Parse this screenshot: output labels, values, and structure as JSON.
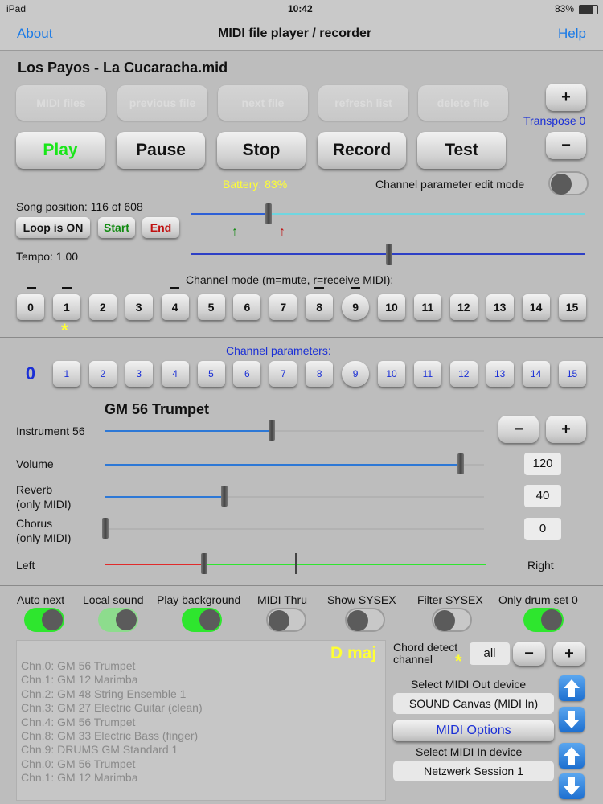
{
  "status": {
    "device": "iPad",
    "time": "10:42",
    "battery": "83%"
  },
  "nav": {
    "about": "About",
    "title": "MIDI file player / recorder",
    "help": "Help"
  },
  "file": {
    "name": "Los Payos - La Cucaracha.mid"
  },
  "file_buttons": [
    "MIDI files",
    "previous file",
    "next file",
    "refresh list",
    "delete file"
  ],
  "transport": {
    "play": "Play",
    "pause": "Pause",
    "stop": "Stop",
    "record": "Record",
    "test": "Test"
  },
  "transpose": {
    "plus": "+",
    "minus": "−",
    "label": "Transpose 0"
  },
  "battery_text": "Battery: 83%",
  "edit_mode": {
    "label": "Channel parameter edit mode",
    "on": false
  },
  "song": {
    "position_label": "Song position: 116 of 608",
    "position": 116,
    "total": 608,
    "loop": "Loop is ON",
    "start": "Start",
    "end": "End"
  },
  "tempo": {
    "label": "Tempo: 1.00",
    "value": 1.0
  },
  "channel_mode": {
    "title": "Channel mode (m=mute, r=receive MIDI):",
    "channels": [
      "0",
      "1",
      "2",
      "3",
      "4",
      "5",
      "6",
      "7",
      "8",
      "9",
      "10",
      "11",
      "12",
      "13",
      "14",
      "15"
    ],
    "marked_channel": "1",
    "marker": "*"
  },
  "channel_params": {
    "title": "Channel parameters:",
    "channels": [
      "0",
      "1",
      "2",
      "3",
      "4",
      "5",
      "6",
      "7",
      "8",
      "9",
      "10",
      "11",
      "12",
      "13",
      "14",
      "15"
    ],
    "selected": "0"
  },
  "instrument": {
    "name": "GM 56  Trumpet",
    "label": "Instrument 56",
    "minus": "−",
    "plus": "+",
    "value": 56
  },
  "volume": {
    "label": "Volume",
    "value": "120"
  },
  "reverb": {
    "label1": "Reverb",
    "label2": "(only MIDI)",
    "value": "40"
  },
  "chorus": {
    "label1": "Chorus",
    "label2": "(only MIDI)",
    "value": "0"
  },
  "balance": {
    "left": "Left",
    "right": "Right"
  },
  "options": [
    {
      "label": "Auto next",
      "state": "on"
    },
    {
      "label": "Local sound",
      "state": "dim"
    },
    {
      "label": "Play background",
      "state": "on"
    },
    {
      "label": "MIDI Thru",
      "state": "off"
    },
    {
      "label": "Show SYSEX",
      "state": "off"
    },
    {
      "label": "Filter SYSEX",
      "state": "off"
    },
    {
      "label": "Only drum set 0",
      "state": "on"
    }
  ],
  "chord": {
    "key": "D maj",
    "detect_label1": "Chord detect",
    "detect_label2": "channel",
    "channel": "all",
    "marker": "*",
    "minus": "−",
    "plus": "+"
  },
  "channel_list": [
    "Chn.0: GM 56  Trumpet",
    "Chn.1: GM 12  Marimba",
    "Chn.2: GM 48  String Ensemble 1",
    "Chn.3: GM 27  Electric Guitar (clean)",
    "Chn.4: GM 56  Trumpet",
    "Chn.8: GM 33  Electric Bass (finger)",
    "Chn.9: DRUMS GM Standard 1",
    "Chn.0: GM 56  Trumpet",
    "Chn.1: GM 12  Marimba"
  ],
  "midi_out": {
    "title": "Select MIDI Out device",
    "device": "SOUND Canvas (MIDI In)"
  },
  "midi_options": "MIDI Options",
  "midi_in": {
    "title": "Select MIDI In device",
    "device": "Netzwerk Session 1"
  },
  "colors": {
    "accent": "#1a7ae6",
    "on_toggle": "#2ee62e",
    "battery": "#ffff33",
    "play": "#19e619",
    "end": "#c01010",
    "start": "#118a11"
  }
}
